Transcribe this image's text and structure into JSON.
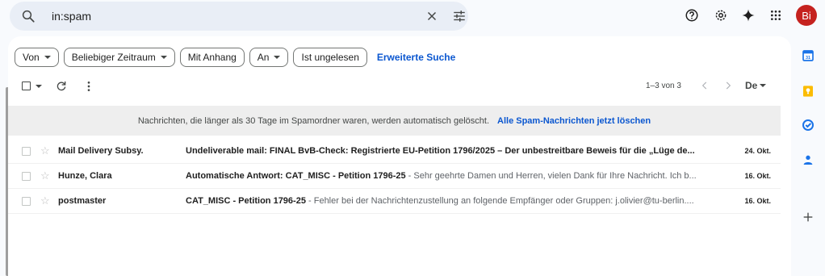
{
  "search": {
    "query": "in:spam",
    "icon": "search-icon"
  },
  "header": {
    "icons": [
      "help-icon",
      "settings-icon",
      "gemini-icon",
      "apps-grid-icon"
    ],
    "avatar_initials": "Bi",
    "avatar_color": "#c5221f"
  },
  "filters": {
    "chips": [
      {
        "label": "Von",
        "dropdown": true
      },
      {
        "label": "Beliebiger Zeitraum",
        "dropdown": true
      },
      {
        "label": "Mit Anhang",
        "dropdown": false
      },
      {
        "label": "An",
        "dropdown": true
      },
      {
        "label": "Ist ungelesen",
        "dropdown": false
      }
    ],
    "advanced_label": "Erweiterte Suche"
  },
  "toolbar": {
    "range_label": "1–3 von 3",
    "lang_label": "De"
  },
  "notice": {
    "text": "Nachrichten, die länger als 30 Tage im Spamordner waren, werden automatisch gelöscht.",
    "link": "Alle Spam-Nachrichten jetzt löschen"
  },
  "messages": [
    {
      "sender": "Mail Delivery Subsy.",
      "subject": "Undeliverable mail: FINAL BvB-Check: Registrierte EU-Petition 1796/2025 – Der unbestreitbare Beweis für die „Lüge de...",
      "snippet": "",
      "date": "24. Okt."
    },
    {
      "sender": "Hunze, Clara",
      "subject": "Automatische Antwort: CAT_MISC - Petition 1796-25",
      "snippet": " - Sehr geehrte Damen und Herren, vielen Dank für Ihre Nachricht. Ich b...",
      "date": "16. Okt."
    },
    {
      "sender": "postmaster",
      "subject": "CAT_MISC - Petition 1796-25",
      "snippet": " - Fehler bei der Nachrichtenzustellung an folgende Empfänger oder Gruppen: j.olivier@tu-berlin....",
      "date": "16. Okt."
    }
  ],
  "side_panel": {
    "icons": [
      "calendar-icon",
      "keep-icon",
      "tasks-icon",
      "contacts-icon",
      "add-icon"
    ],
    "colors": {
      "calendar": "#1a73e8",
      "keep": "#fbbc04",
      "tasks": "#1a73e8",
      "contacts": "#1a73e8"
    }
  },
  "colors": {
    "accent": "#0b57d0",
    "search_bg": "#e9eef6",
    "notice_bg": "#eeeeee"
  }
}
